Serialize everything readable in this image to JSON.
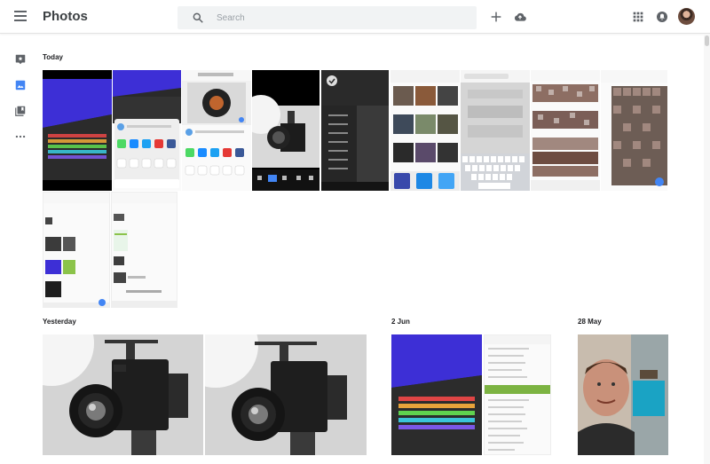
{
  "header": {
    "title": "Photos",
    "search_placeholder": "Search",
    "icons": [
      "menu-icon",
      "search-icon",
      "add-icon",
      "upload-cloud-icon",
      "apps-grid-icon",
      "notifications-icon",
      "account-avatar"
    ]
  },
  "rail": {
    "items": [
      "assistant-icon",
      "photos-icon",
      "albums-icon",
      "more-icon"
    ],
    "active": "photos-icon",
    "accent": "#4285f4"
  },
  "sections": {
    "today": "Today",
    "yesterday": "Yesterday",
    "jun2": "2 Jun",
    "may28": "28 May"
  }
}
